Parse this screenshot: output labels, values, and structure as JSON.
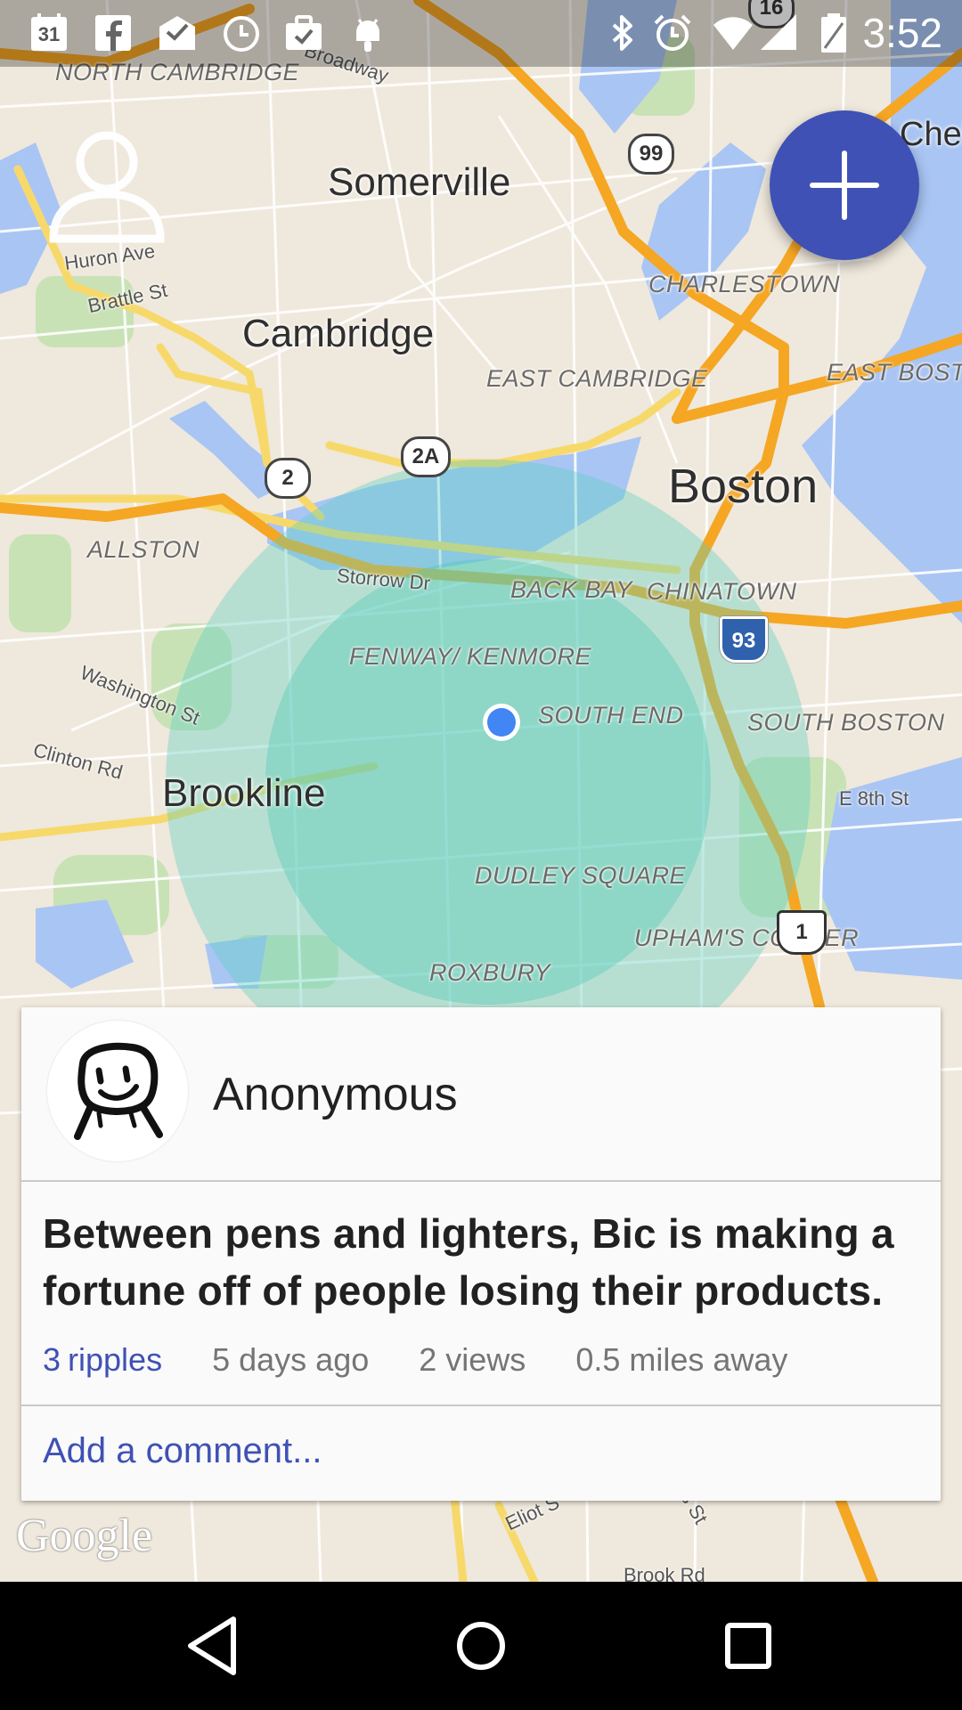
{
  "status_bar": {
    "time": "3:52",
    "calendar_day": "31",
    "left_icons": [
      "calendar-icon",
      "facebook-icon",
      "mail-icon",
      "clock-icon",
      "briefcase-icon",
      "android-icon"
    ],
    "right_icons": [
      "bluetooth-icon",
      "alarm-icon",
      "wifi-icon",
      "signal-icon",
      "battery-icon"
    ]
  },
  "map": {
    "cities": [
      "Somerville",
      "Cambridge",
      "Boston",
      "Brookline"
    ],
    "areas": [
      "NORTH CAMBRIDGE",
      "CHARLESTOWN",
      "EAST CAMBRIDGE",
      "EAST BOSTO",
      "ALLSTON",
      "BACK BAY",
      "CHINATOWN",
      "FENWAY/ KENMORE",
      "SOUTH END",
      "SOUTH BOSTON",
      "DUDLEY SQUARE",
      "UPHAM'S CORNER",
      "ROXBURY"
    ],
    "streets": [
      "Broadway",
      "Huron Ave",
      "Brattle St",
      "Storrow Dr",
      "Washington St",
      "Clinton Rd",
      "E 8th St",
      "Eliot S",
      "s St",
      "Brook Rd"
    ],
    "partial_city": "Chel",
    "route_shields": [
      "16",
      "99",
      "2",
      "2A",
      "93",
      "1"
    ],
    "provider": "Google",
    "colors": {
      "water": "#a9c5f4",
      "highway": "#f5a623",
      "radius": "#59cfc0",
      "location_dot": "#4285f4",
      "accent": "#3f51b5"
    }
  },
  "controls": {
    "fab_icon": "plus-icon",
    "profile_icon": "person-icon"
  },
  "post": {
    "author": "Anonymous",
    "text": "Between pens and lighters, Bic is making a fortune off of people losing their products.",
    "ripples_count": "3",
    "ripples_label": "ripples",
    "age": "5 days ago",
    "views": "2 views",
    "distance": "0.5 miles away",
    "comment_placeholder": "Add a comment..."
  },
  "nav_bar": [
    "back-icon",
    "home-icon",
    "recents-icon"
  ]
}
